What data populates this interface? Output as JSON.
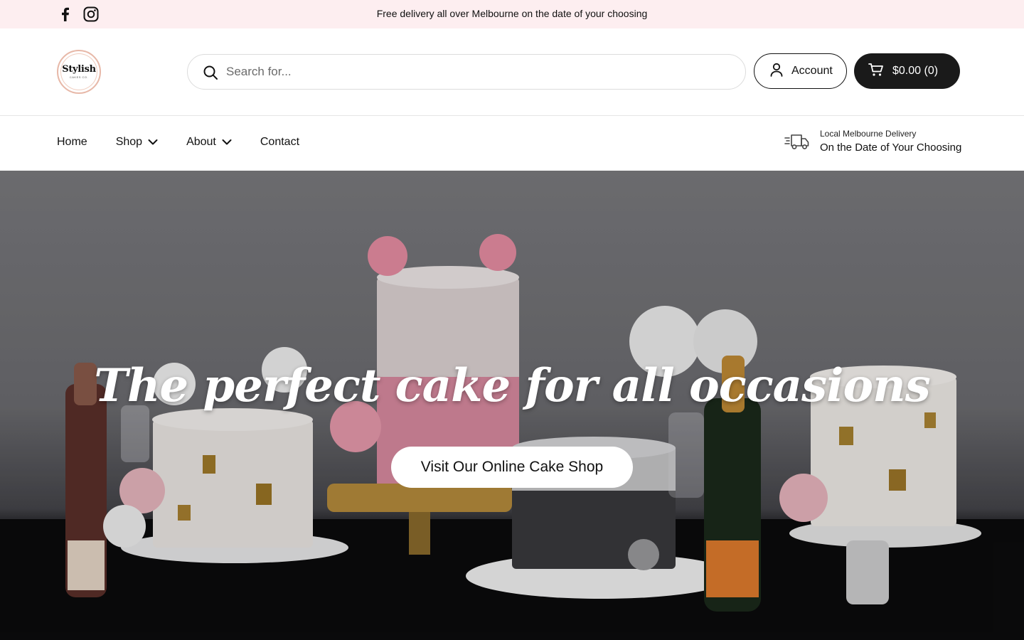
{
  "announcement": {
    "text": "Free delivery all over Melbourne on the date of your choosing",
    "socials": [
      "facebook-icon",
      "instagram-icon"
    ]
  },
  "header": {
    "logo_text": "Stylish",
    "logo_subtext": "CAKES CO.",
    "search_placeholder": "Search for...",
    "account_label": "Account",
    "cart_label": "$0.00 (0)"
  },
  "nav": {
    "items": [
      {
        "label": "Home",
        "dropdown": false
      },
      {
        "label": "Shop",
        "dropdown": true
      },
      {
        "label": "About",
        "dropdown": true
      },
      {
        "label": "Contact",
        "dropdown": false
      }
    ],
    "delivery_small": "Local Melbourne Delivery",
    "delivery_main": "On the Date of Your Choosing"
  },
  "hero": {
    "title": "The perfect cake for all occasions",
    "button_label": "Visit Our Online Cake Shop"
  },
  "colors": {
    "announcement_bg": "#fdeef0",
    "cart_bg": "#1a1a1a",
    "logo_ring": "#e7b8a8"
  }
}
